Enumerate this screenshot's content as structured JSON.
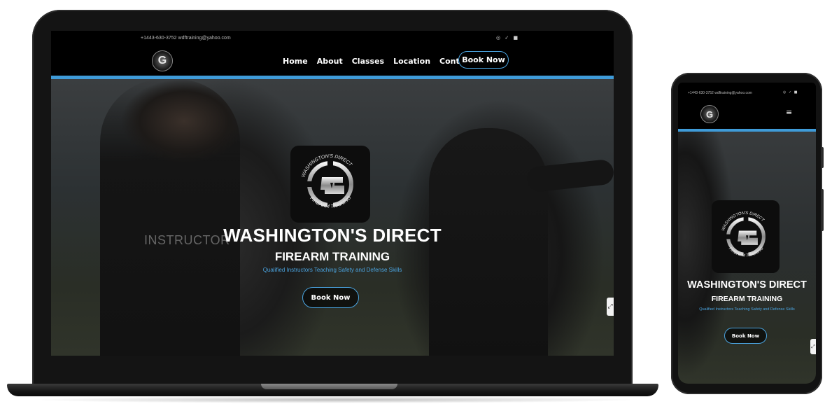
{
  "site": {
    "contact_line": "+1443-630-3752   wdftraining@yahoo.com",
    "social_icons": [
      "instagram-icon",
      "twitter-icon",
      "facebook-icon"
    ]
  },
  "nav": {
    "logo_letter": "G",
    "links": [
      "Home",
      "About",
      "Classes",
      "Location",
      "Contact"
    ],
    "cta_label": "Book Now"
  },
  "hero": {
    "watermark_text": "INSTRUCTOR",
    "badge_top_text": "WASHINGTON'S DIRECT",
    "badge_bottom_text": "FIREARM TRAINING",
    "title": "WASHINGTON'S DIRECT",
    "subtitle": "FIREARM TRAINING",
    "tagline": "Qualified Instructors Teaching Safety and Defense Skills",
    "cta_label": "Book Now"
  },
  "mobile": {
    "menu_icon": "≡"
  },
  "colors": {
    "accent": "#3f9bd8",
    "background": "#000000",
    "text": "#ffffff"
  }
}
